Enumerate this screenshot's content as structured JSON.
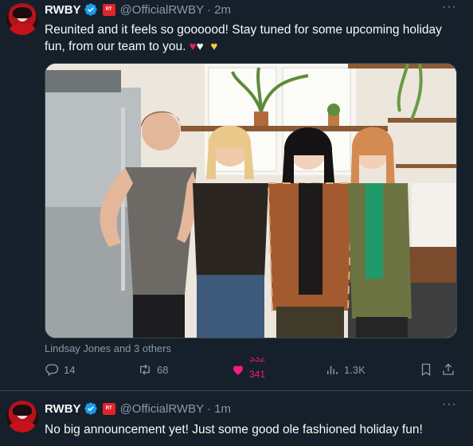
{
  "tweets": [
    {
      "author": {
        "name": "RWBY",
        "handle": "@OfficialRWBY",
        "time": "2m",
        "affiliate_badge": "RT"
      },
      "text": "Reunited and it feels so goooood! Stay tuned for some upcoming holiday fun, from our team to you.",
      "emojis": [
        "red-heart",
        "white-heart",
        "black-heart",
        "yellow-heart"
      ],
      "tagged": "Lindsay Jones and 3 others",
      "stats": {
        "replies": "14",
        "retweets": "68",
        "likes_prev": "332",
        "likes": "341",
        "views": "1.3K"
      }
    },
    {
      "author": {
        "name": "RWBY",
        "handle": "@OfficialRWBY",
        "time": "1m",
        "affiliate_badge": "RT"
      },
      "text": "No big announcement yet! Just some good ole fashioned holiday fun!"
    }
  ],
  "more_label": "···",
  "colors": {
    "background": "#15202b",
    "text": "#f7f9f9",
    "muted": "#8b98a5",
    "like": "#f91880",
    "verified": "#1d9bf0"
  }
}
